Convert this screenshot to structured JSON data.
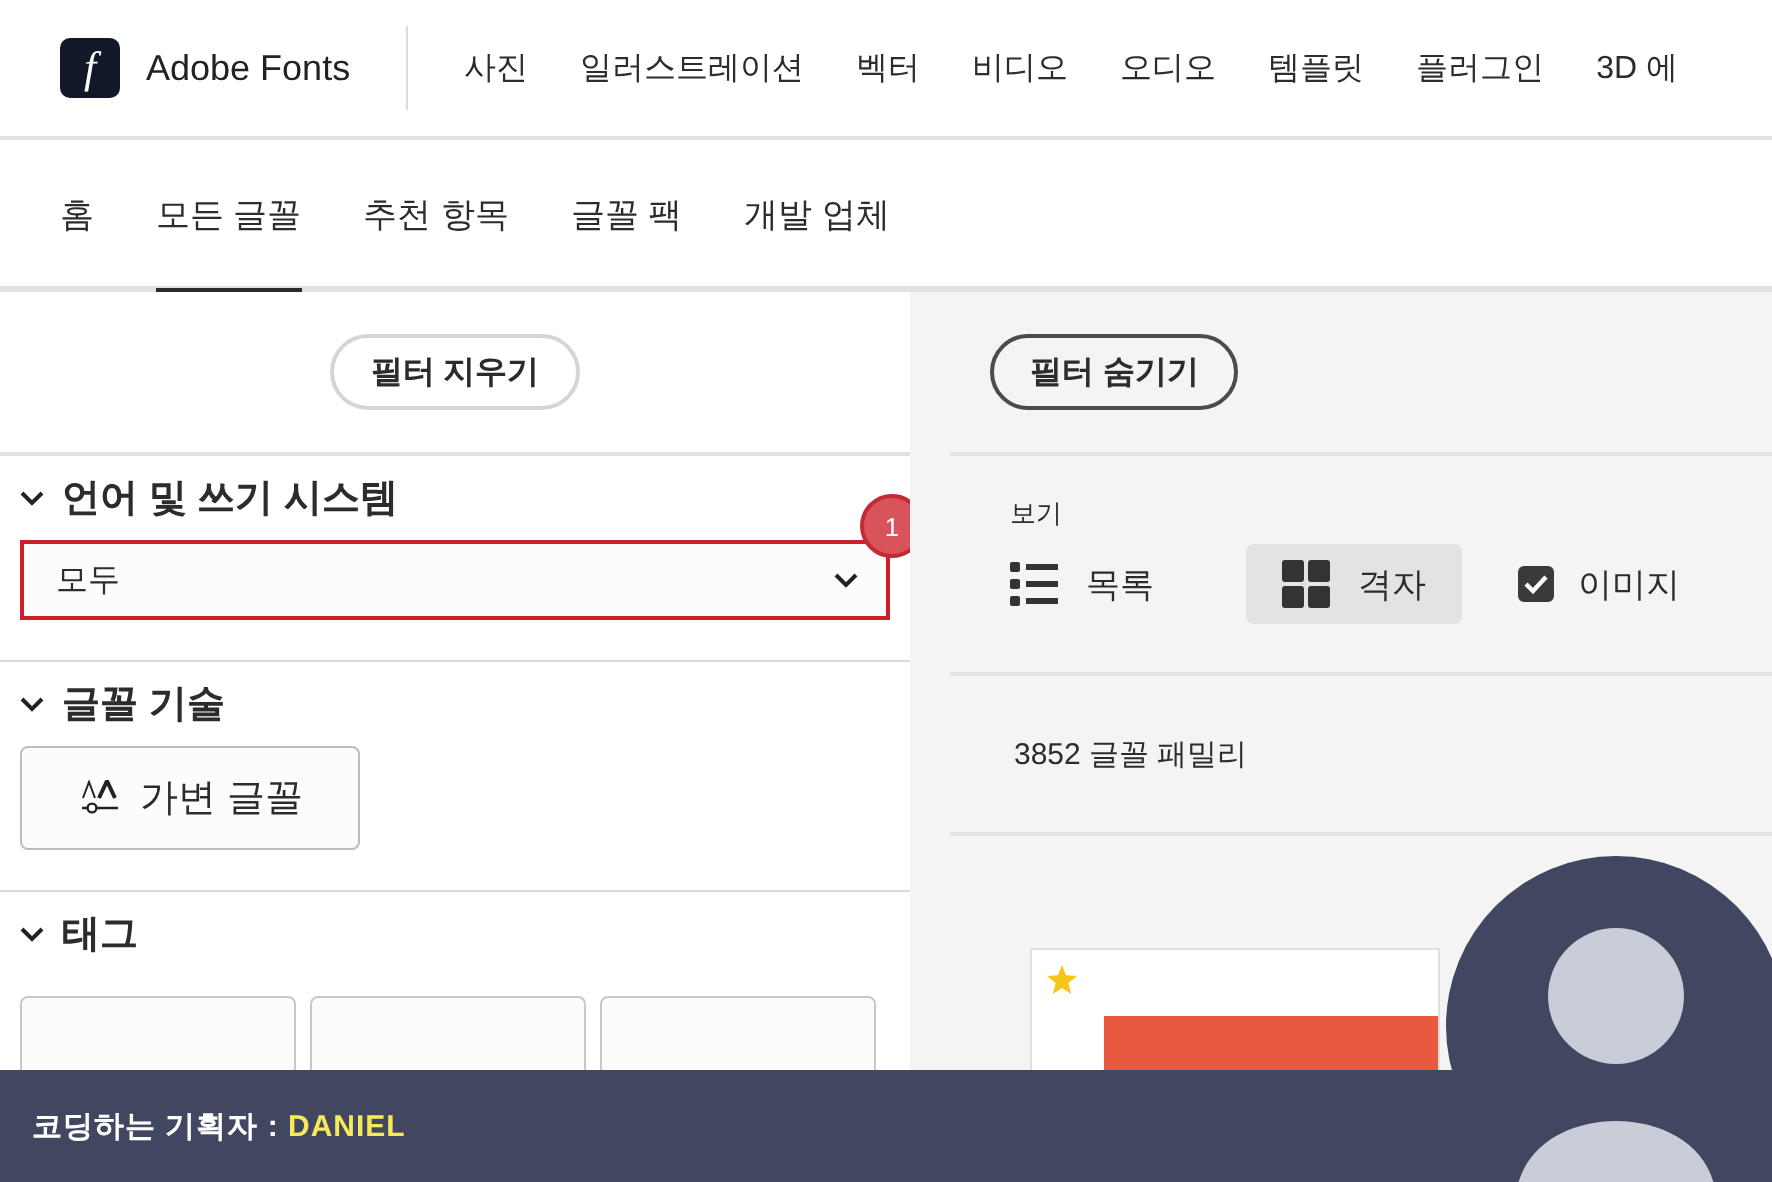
{
  "header": {
    "logo": {
      "glyph": "f",
      "name": "Adobe Fonts"
    },
    "nav": [
      "사진",
      "일러스트레이션",
      "벡터",
      "비디오",
      "오디오",
      "템플릿",
      "플러그인",
      "3D 에"
    ]
  },
  "tabs": [
    {
      "label": "홈",
      "selected": false
    },
    {
      "label": "모든 글꼴",
      "selected": true
    },
    {
      "label": "추천 항목",
      "selected": false
    },
    {
      "label": "글꼴 팩",
      "selected": false
    },
    {
      "label": "개발 업체",
      "selected": false
    }
  ],
  "filters": {
    "clear_button": "필터 지우기",
    "sections": [
      {
        "title": "언어 및 쓰기 시스템",
        "expanded": true,
        "kind": "select",
        "value": "모두",
        "highlighted": true,
        "badge": "1"
      },
      {
        "title": "글꼴 기술",
        "expanded": true,
        "kind": "button",
        "button": "가변 글꼴"
      },
      {
        "title": "태그",
        "expanded": true,
        "kind": "tags"
      }
    ]
  },
  "results": {
    "hide_filters_button": "필터 숨기기",
    "view": {
      "label": "보기",
      "options": [
        {
          "kind": "list",
          "label": "목록",
          "selected": false
        },
        {
          "kind": "grid",
          "label": "격자",
          "selected": true
        }
      ],
      "images": {
        "label": "이미지",
        "checked": true
      }
    },
    "count": "3852 글꼴 패밀리",
    "cards": [
      {
        "starred": true
      }
    ]
  },
  "banner": {
    "prefix": "코딩하는 기획자 :",
    "name": "DANIEL"
  }
}
